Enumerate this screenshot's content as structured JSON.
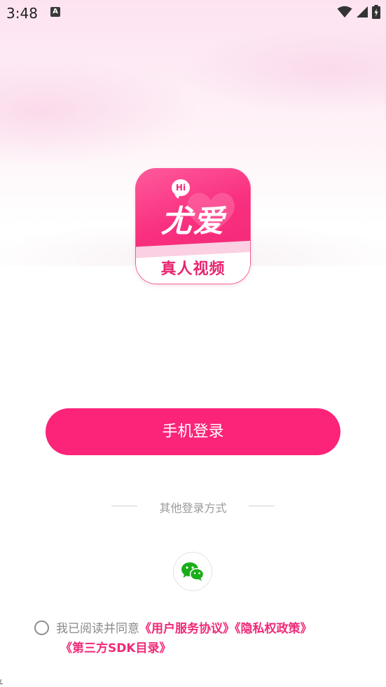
{
  "status_bar": {
    "time": "3:48",
    "notification_icon": "A",
    "icons": [
      "wifi-icon",
      "signal-icon",
      "battery-charging-icon"
    ]
  },
  "logo": {
    "bubble": "Hi",
    "title": "尤爱",
    "subtitle": "真人视频"
  },
  "login": {
    "phone_button": "手机登录",
    "other_methods": "其他登录方式",
    "other_icons": [
      "wechat-icon"
    ]
  },
  "agreement": {
    "prefix": "我已阅读并同意",
    "user_agreement": "《用户服务协议》",
    "privacy_policy": "《隐私权政策》",
    "sdk_list": "《第三方SDK目录》"
  },
  "colors": {
    "accent": "#fb2478",
    "link": "#f02a78",
    "wechat": "#1aad19"
  }
}
